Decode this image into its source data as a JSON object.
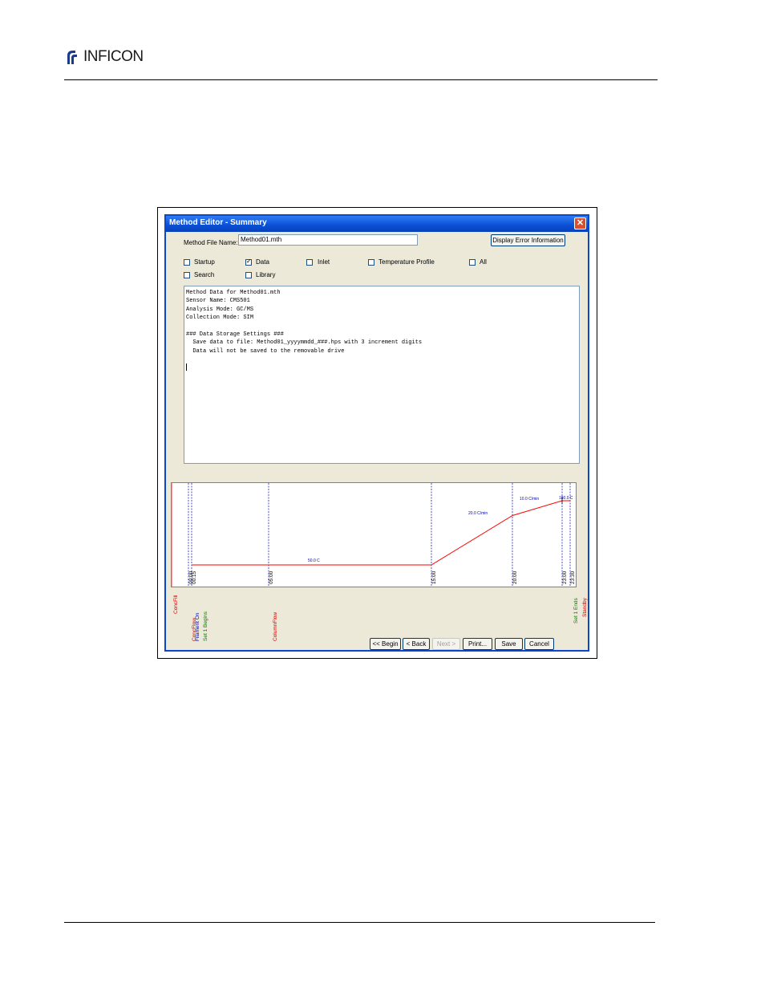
{
  "brand": {
    "name": "INFICON"
  },
  "dialog": {
    "title": "Method Editor - Summary",
    "file_name_label": "Method File Name:",
    "file_name_value": "Method01.mth",
    "display_error_button": "Display Error Information",
    "checkboxes": [
      {
        "label": "Startup",
        "checked": false
      },
      {
        "label": "Data",
        "checked": true
      },
      {
        "label": "Inlet",
        "checked": false
      },
      {
        "label": "Temperature Profile",
        "checked": false
      },
      {
        "label": "All",
        "checked": false
      },
      {
        "label": "Search",
        "checked": false
      },
      {
        "label": "Library",
        "checked": false
      }
    ],
    "summary_lines": [
      "Method Data for Method01.mth",
      "Sensor Name: CMS501",
      "Analysis Mode: GC/MS",
      "Collection Mode: SIM",
      "",
      "### Data Storage Settings ###",
      "  Save data to file: Method01_yyyymmdd_###.hps with 3 increment digits",
      "  Data will not be saved to the removable drive"
    ],
    "buttons": {
      "begin": "<< Begin",
      "back": "< Back",
      "next": "Next >",
      "print": "Print...",
      "save": "Save",
      "cancel": "Cancel"
    }
  },
  "chart_data": {
    "type": "line",
    "x_ticks": [
      "00:00",
      "00:15",
      "05:00",
      "15:00",
      "20:00",
      "23:00",
      "23:30"
    ],
    "x": [
      0.25,
      15.0,
      20.0,
      23.0
    ],
    "y": [
      50,
      50,
      150,
      180
    ],
    "annotations": [
      "50.0 C",
      "20.0 C/min",
      "10.0 C/min",
      "180.0 C"
    ],
    "events": [
      {
        "label": "ConcFill",
        "color": "#cc0000"
      },
      {
        "label": "ConcFlow",
        "color": "#cc0000"
      },
      {
        "label": "Filament On",
        "color": "#0000cc"
      },
      {
        "label": "Set 1 Begins",
        "color": "#008000"
      },
      {
        "label": "ColumnFlow",
        "color": "#cc0000"
      },
      {
        "label": "Set 1 Ends",
        "color": "#008000"
      },
      {
        "label": "Standby",
        "color": "#cc0000"
      }
    ],
    "colors": {
      "profile": "#ff0000",
      "markers": "#0000aa"
    }
  }
}
